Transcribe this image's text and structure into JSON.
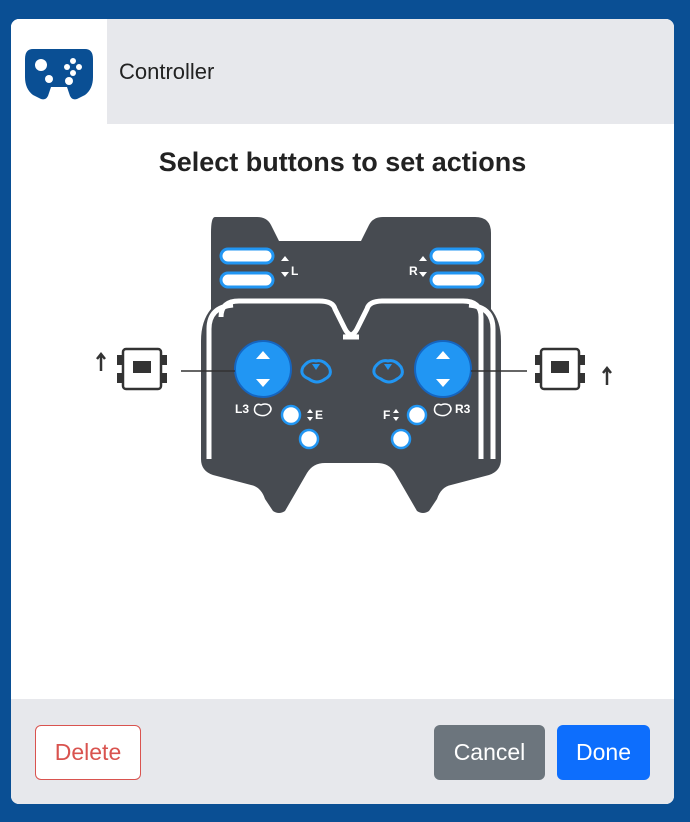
{
  "header": {
    "icon": "gamepad-icon",
    "title": "Controller"
  },
  "main": {
    "heading": "Select buttons to set actions"
  },
  "diagram": {
    "labels": {
      "left_bumper": "L",
      "right_bumper": "R",
      "left_stick_press": "L3",
      "right_stick_press": "R3",
      "button_e": "E",
      "button_f": "F"
    },
    "colors": {
      "body": "#474b51",
      "accent": "#2196f3",
      "outline": "#ffffff"
    }
  },
  "footer": {
    "delete_label": "Delete",
    "cancel_label": "Cancel",
    "done_label": "Done"
  },
  "colors": {
    "frame": "#0a4f94",
    "header_bg": "#e7e8ec",
    "delete": "#d9534f",
    "cancel": "#6c757d",
    "done": "#0d6efd"
  }
}
